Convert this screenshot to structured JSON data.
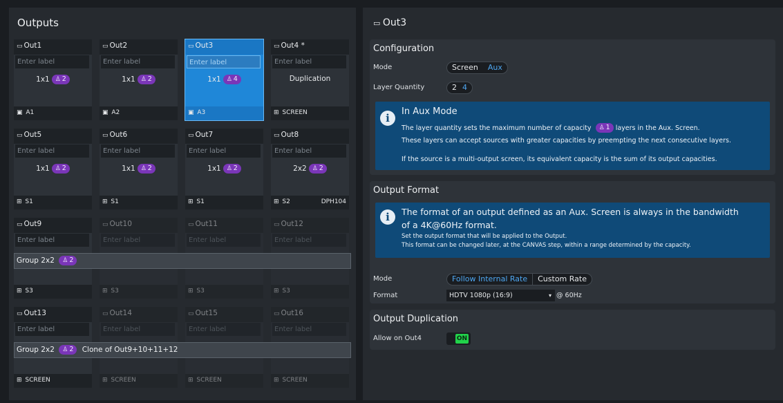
{
  "left": {
    "title": "Outputs",
    "cards": [
      {
        "name": "Out1",
        "label_ph": "Enter label",
        "cfg": "1x1",
        "cap": "2",
        "dev": "A1",
        "dev_icon": "monitor-icon",
        "dev2": ""
      },
      {
        "name": "Out2",
        "label_ph": "Enter label",
        "cfg": "1x1",
        "cap": "2",
        "dev": "A2",
        "dev_icon": "monitor-icon",
        "dev2": ""
      },
      {
        "name": "Out3",
        "label_ph": "Enter label",
        "cfg": "1x1",
        "cap": "4",
        "dev": "A3",
        "dev_icon": "monitor-icon",
        "dev2": ""
      },
      {
        "name": "Out4 *",
        "label_ph": "Enter label",
        "cfg": "Duplication",
        "cap": "",
        "dev": "SCREEN",
        "dev_icon": "screen-icon",
        "dev2": ""
      },
      {
        "name": "Out5",
        "label_ph": "Enter label",
        "cfg": "1x1",
        "cap": "2",
        "dev": "S1",
        "dev_icon": "screen-icon",
        "dev2": ""
      },
      {
        "name": "Out6",
        "label_ph": "Enter label",
        "cfg": "1x1",
        "cap": "2",
        "dev": "S1",
        "dev_icon": "screen-icon",
        "dev2": ""
      },
      {
        "name": "Out7",
        "label_ph": "Enter label",
        "cfg": "1x1",
        "cap": "2",
        "dev": "S1",
        "dev_icon": "screen-icon",
        "dev2": ""
      },
      {
        "name": "Out8",
        "label_ph": "Enter label",
        "cfg": "2x2",
        "cap": "2",
        "dev": "S2",
        "dev_icon": "screen-icon",
        "dev2": "DPH104"
      },
      {
        "name": "Out9",
        "label_ph": "Enter label",
        "cfg": "",
        "cap": "",
        "dev": "S3",
        "dev_icon": "screen-icon",
        "dev2": ""
      },
      {
        "name": "Out10",
        "label_ph": "Enter label",
        "cfg": "",
        "cap": "",
        "dev": "S3",
        "dev_icon": "screen-icon",
        "dev2": ""
      },
      {
        "name": "Out11",
        "label_ph": "Enter label",
        "cfg": "",
        "cap": "",
        "dev": "S3",
        "dev_icon": "screen-icon",
        "dev2": ""
      },
      {
        "name": "Out12",
        "label_ph": "Enter label",
        "cfg": "",
        "cap": "",
        "dev": "S3",
        "dev_icon": "screen-icon",
        "dev2": ""
      },
      {
        "name": "Out13",
        "label_ph": "Enter label",
        "cfg": "",
        "cap": "",
        "dev": "SCREEN",
        "dev_icon": "screen-icon",
        "dev2": ""
      },
      {
        "name": "Out14",
        "label_ph": "Enter label",
        "cfg": "",
        "cap": "",
        "dev": "SCREEN",
        "dev_icon": "screen-icon",
        "dev2": ""
      },
      {
        "name": "Out15",
        "label_ph": "Enter label",
        "cfg": "",
        "cap": "",
        "dev": "SCREEN",
        "dev_icon": "screen-icon",
        "dev2": ""
      },
      {
        "name": "Out16",
        "label_ph": "Enter label",
        "cfg": "",
        "cap": "",
        "dev": "SCREEN",
        "dev_icon": "screen-icon",
        "dev2": ""
      }
    ],
    "group1": {
      "label": "Group 2x2",
      "cap": "2",
      "extra": ""
    },
    "group2": {
      "label": "Group 2x2",
      "cap": "2",
      "extra": "Clone of Out9+10+11+12"
    }
  },
  "right": {
    "title": "Out3",
    "config": {
      "title": "Configuration",
      "mode_label": "Mode",
      "mode_opts": [
        "Screen",
        "Aux"
      ],
      "layer_label": "Layer Quantity",
      "layer_opts": [
        "2",
        "4"
      ],
      "info_title": "In Aux Mode",
      "info_l1a": "The layer quantity sets the maximum number of capacity",
      "info_l1cap": "1",
      "info_l1b": "layers in the Aux. Screen.",
      "info_l2": "These layers can accept sources with greater capacities by preempting the next consecutive layers.",
      "info_l3": "If the source is a multi-output screen, its equivalent capacity is the sum of its output capacities."
    },
    "format": {
      "title": "Output Format",
      "info_big1": "The format of an output defined as an Aux. Screen is always in the bandwidth",
      "info_big2": "of a 4K@60Hz format.",
      "info_s1": "Set the output format that will be applied to the Output.",
      "info_s2": "This format can be changed later, at the CANVAS step, within a range determined by the capacity.",
      "mode_label": "Mode",
      "mode_opts": [
        "Follow Internal Rate",
        "Custom Rate"
      ],
      "format_label": "Format",
      "format_value": "HDTV 1080p (16:9)",
      "rate": "@ 60Hz"
    },
    "dup": {
      "title": "Output Duplication",
      "allow_label": "Allow on Out4",
      "toggle": "ON"
    }
  },
  "colors": {
    "accent": "#1f87d8",
    "badge": "#7a36b8",
    "info_bg": "#0f4a78",
    "toggle_on": "#21d24a"
  }
}
